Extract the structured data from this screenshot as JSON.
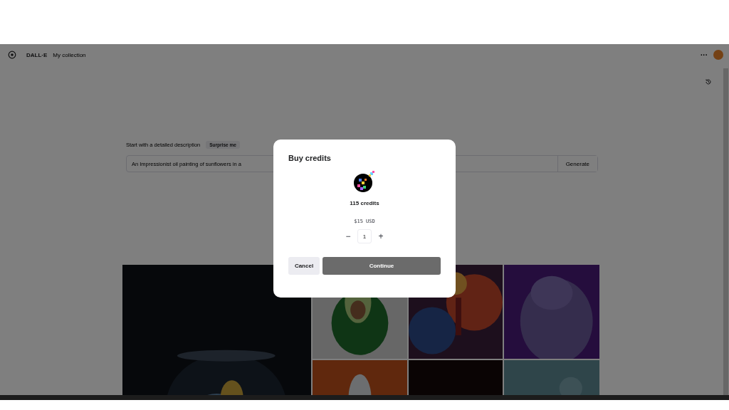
{
  "header": {
    "brand": "DALL·E",
    "nav_link": "My collection",
    "more_menu": "···"
  },
  "prompt": {
    "label": "Start with a detailed description",
    "surprise_button": "Surprise me",
    "placeholder": "An Impressionist oil painting of sunflowers in a",
    "generate_button": "Generate"
  },
  "dialog": {
    "title": "Buy credits",
    "credits": "115 credits",
    "price": "$15",
    "currency": "USD",
    "quantity": "1",
    "decrement": "−",
    "increment": "+",
    "buttons": [
      {
        "label": "Cancel",
        "kind": "secondary"
      },
      {
        "label": "Continue",
        "kind": "primary"
      }
    ]
  }
}
